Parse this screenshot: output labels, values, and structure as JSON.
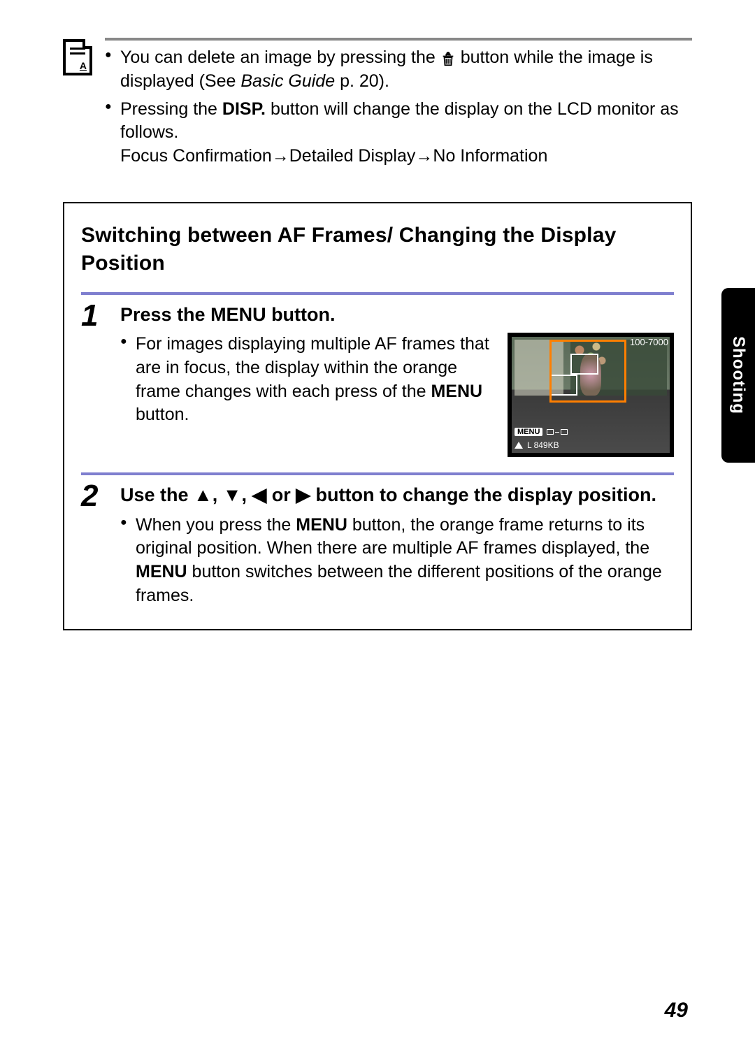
{
  "top_note": {
    "b1_pre": "You can delete an image by pressing the ",
    "b1_post": " button while the image is displayed (See ",
    "b1_guide": "Basic Guide",
    "b1_sfx": " p. 20).",
    "b2_pre": "Pressing the ",
    "b2_disp": "DISP.",
    "b2_post": " button will change the display on the LCD monitor as follows.",
    "b2_seq": "Focus Confirmation→Detailed Display→No Information"
  },
  "section": {
    "title": "Switching between AF Frames/ Changing the Display Position",
    "step1": {
      "num": "1",
      "head": "Press the MENU button.",
      "text_pre": "For images displaying multiple AF frames that are in focus, the display within the orange frame changes with each press of the ",
      "menu": "MENU",
      "text_post": " button."
    },
    "step2": {
      "num": "2",
      "head_pre": "Use the ",
      "head_arrows": "▲, ▼, ◀ or ▶",
      "head_post": " button to change the display position.",
      "text_pre": "When you press the ",
      "menu1": "MENU",
      "text_mid": " button, the orange frame returns to its original position. When there are multiple AF frames displayed, the ",
      "menu2": "MENU",
      "text_post": " button switches between the different positions of the orange frames."
    }
  },
  "thumb": {
    "top_label": "100-7000",
    "menu_badge": "MENU",
    "size_label": "L  849KB"
  },
  "side_tab": "Shooting",
  "page_number": "49"
}
